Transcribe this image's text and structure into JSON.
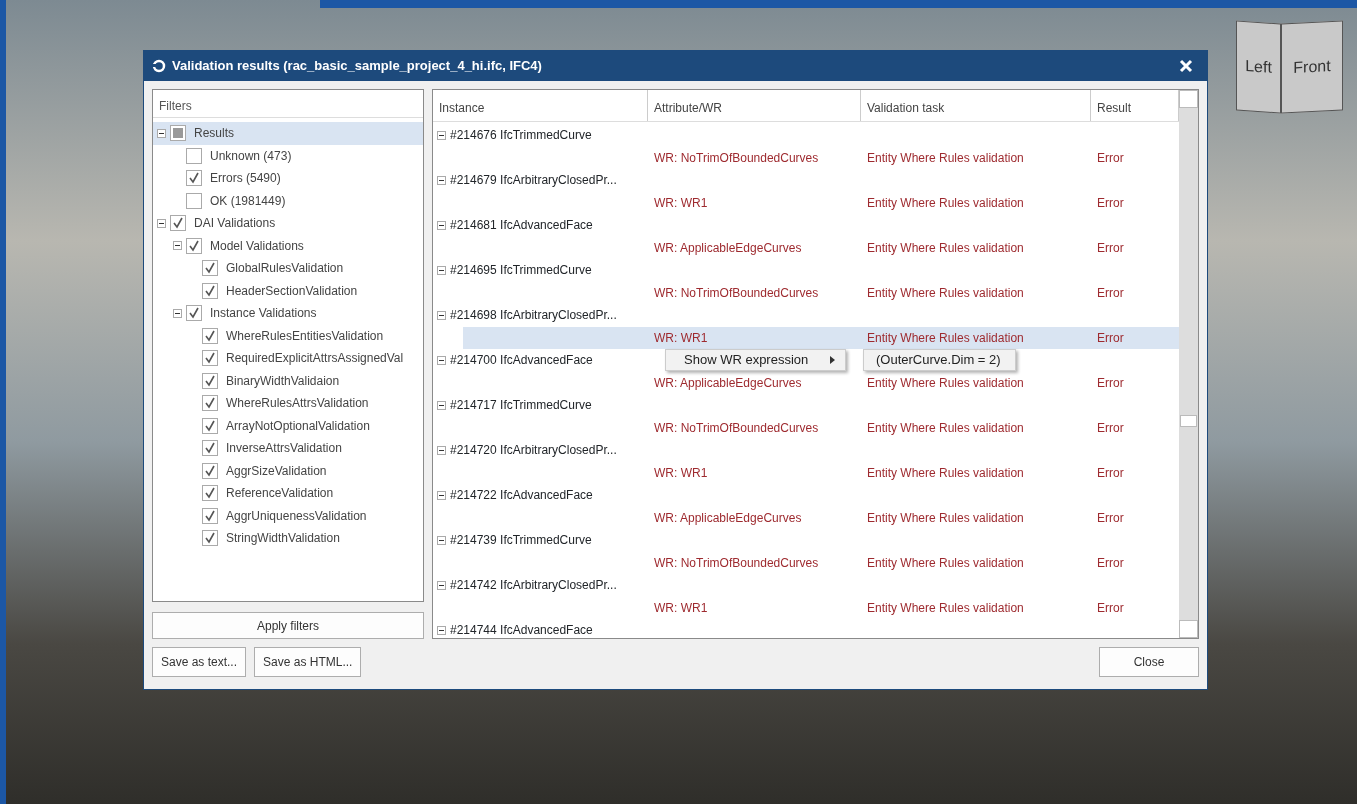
{
  "viewcube": {
    "faces": [
      "Left",
      "Front"
    ]
  },
  "window": {
    "title": "Validation results (rac_basic_sample_project_4_hi.ifc, IFC4)"
  },
  "filters": {
    "header": "Filters",
    "tree": [
      {
        "label": "Results",
        "checked": false,
        "indeterminate": true,
        "expanded": true,
        "selected": true,
        "children": [
          {
            "label": "Unknown (473)",
            "checked": false,
            "selected": false
          },
          {
            "label": "Errors (5490)",
            "checked": true,
            "selected": false
          },
          {
            "label": "OK (1981449)",
            "checked": false,
            "selected": false
          }
        ]
      },
      {
        "label": "DAI Validations",
        "checked": true,
        "expanded": true,
        "selected": false,
        "children": [
          {
            "label": "Model Validations",
            "checked": true,
            "expanded": true,
            "selected": false,
            "children": [
              {
                "label": "GlobalRulesValidation",
                "checked": true,
                "selected": false
              },
              {
                "label": "HeaderSectionValidation",
                "checked": true,
                "selected": false
              }
            ]
          },
          {
            "label": "Instance Validations",
            "checked": true,
            "expanded": true,
            "selected": false,
            "children": [
              {
                "label": "WhereRulesEntitiesValidation",
                "checked": true,
                "selected": false
              },
              {
                "label": "RequiredExplicitAttrsAssignedVal",
                "checked": true,
                "selected": false
              },
              {
                "label": "BinaryWidthValidaion",
                "checked": true,
                "selected": false
              },
              {
                "label": "WhereRulesAttrsValidation",
                "checked": true,
                "selected": false
              },
              {
                "label": "ArrayNotOptionalValidation",
                "checked": true,
                "selected": false
              },
              {
                "label": "InverseAttrsValidation",
                "checked": true,
                "selected": false
              },
              {
                "label": "AggrSizeValidation",
                "checked": true,
                "selected": false
              },
              {
                "label": "ReferenceValidation",
                "checked": true,
                "selected": false
              },
              {
                "label": "AggrUniquenessValidation",
                "checked": true,
                "selected": false
              },
              {
                "label": "StringWidthValidation",
                "checked": true,
                "selected": false
              }
            ]
          }
        ]
      }
    ]
  },
  "apply_button": "Apply filters",
  "table": {
    "columns": [
      "Instance",
      "Attribute/WR",
      "Validation task",
      "Result"
    ],
    "rows": [
      {
        "instance": "#214676 IfcTrimmedCurve",
        "expanded": true,
        "children": [
          {
            "attribute": "WR: NoTrimOfBoundedCurves",
            "task": "Entity Where Rules validation",
            "result": "Error",
            "selected": false
          }
        ]
      },
      {
        "instance": "#214679 IfcArbitraryClosedPr...",
        "expanded": true,
        "children": [
          {
            "attribute": "WR: WR1",
            "task": "Entity Where Rules validation",
            "result": "Error",
            "selected": false
          }
        ]
      },
      {
        "instance": "#214681 IfcAdvancedFace",
        "expanded": true,
        "children": [
          {
            "attribute": "WR: ApplicableEdgeCurves",
            "task": "Entity Where Rules validation",
            "result": "Error",
            "selected": false
          }
        ]
      },
      {
        "instance": "#214695 IfcTrimmedCurve",
        "expanded": true,
        "children": [
          {
            "attribute": "WR: NoTrimOfBoundedCurves",
            "task": "Entity Where Rules validation",
            "result": "Error",
            "selected": false
          }
        ]
      },
      {
        "instance": "#214698 IfcArbitraryClosedPr...",
        "expanded": true,
        "children": [
          {
            "attribute": "WR: WR1",
            "task": "Entity Where Rules validation",
            "result": "Error",
            "selected": true
          }
        ]
      },
      {
        "instance": "#214700 IfcAdvancedFace",
        "expanded": true,
        "children": [
          {
            "attribute": "WR: ApplicableEdgeCurves",
            "task": "Entity Where Rules validation",
            "result": "Error",
            "selected": false
          }
        ]
      },
      {
        "instance": "#214717 IfcTrimmedCurve",
        "expanded": true,
        "children": [
          {
            "attribute": "WR: NoTrimOfBoundedCurves",
            "task": "Entity Where Rules validation",
            "result": "Error",
            "selected": false
          }
        ]
      },
      {
        "instance": "#214720 IfcArbitraryClosedPr...",
        "expanded": true,
        "children": [
          {
            "attribute": "WR: WR1",
            "task": "Entity Where Rules validation",
            "result": "Error",
            "selected": false
          }
        ]
      },
      {
        "instance": "#214722 IfcAdvancedFace",
        "expanded": true,
        "children": [
          {
            "attribute": "WR: ApplicableEdgeCurves",
            "task": "Entity Where Rules validation",
            "result": "Error",
            "selected": false
          }
        ]
      },
      {
        "instance": "#214739 IfcTrimmedCurve",
        "expanded": true,
        "children": [
          {
            "attribute": "WR: NoTrimOfBoundedCurves",
            "task": "Entity Where Rules validation",
            "result": "Error",
            "selected": false
          }
        ]
      },
      {
        "instance": "#214742 IfcArbitraryClosedPr...",
        "expanded": true,
        "children": [
          {
            "attribute": "WR: WR1",
            "task": "Entity Where Rules validation",
            "result": "Error",
            "selected": false
          }
        ]
      },
      {
        "instance": "#214744 IfcAdvancedFace",
        "expanded": true,
        "children": []
      }
    ]
  },
  "context_menu": {
    "items": [
      "Show WR expression"
    ],
    "submenu": [
      "(OuterCurve.Dim = 2)"
    ]
  },
  "save_buttons": [
    "Save as text...",
    "Save as HTML..."
  ],
  "close_button": "Close"
}
